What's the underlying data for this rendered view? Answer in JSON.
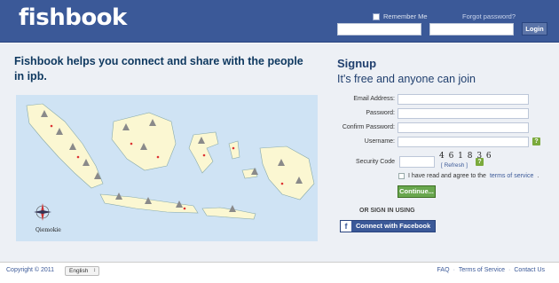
{
  "header": {
    "logo": "fishbook",
    "remember_label": "Remember Me",
    "forgot_label": "Forgot password?",
    "login_label": "Login"
  },
  "tagline": "Fishbook helps you connect and share with the people in ipb.",
  "map": {
    "compass_label": "Qiemokie"
  },
  "signup": {
    "title": "Signup",
    "subtitle": "It's free and anyone can join",
    "fields": {
      "email_label": "Email Address:",
      "password_label": "Password:",
      "confirm_label": "Confirm Password:",
      "username_label": "Username:",
      "security_label": "Security Code"
    },
    "captcha_text": "4 6 1 8 3 6",
    "refresh_label": "[ Refresh ]",
    "help_badge": "?",
    "agree_text": "I have read and agree to the",
    "terms_label": "terms of service",
    "continue_label": "Continue...",
    "or_sign_in": "OR SIGN IN USING",
    "facebook_label": "Connect with Facebook",
    "facebook_icon": "f"
  },
  "footer": {
    "copyright": "Copyright © 2011",
    "language": "English",
    "links": [
      "FAQ",
      "Terms of Service",
      "Contact Us"
    ]
  },
  "colors": {
    "brand_blue": "#3b5998",
    "content_bg": "#edf0f5",
    "continue_green": "#69a74e",
    "map_sea": "#cfe3f4"
  }
}
